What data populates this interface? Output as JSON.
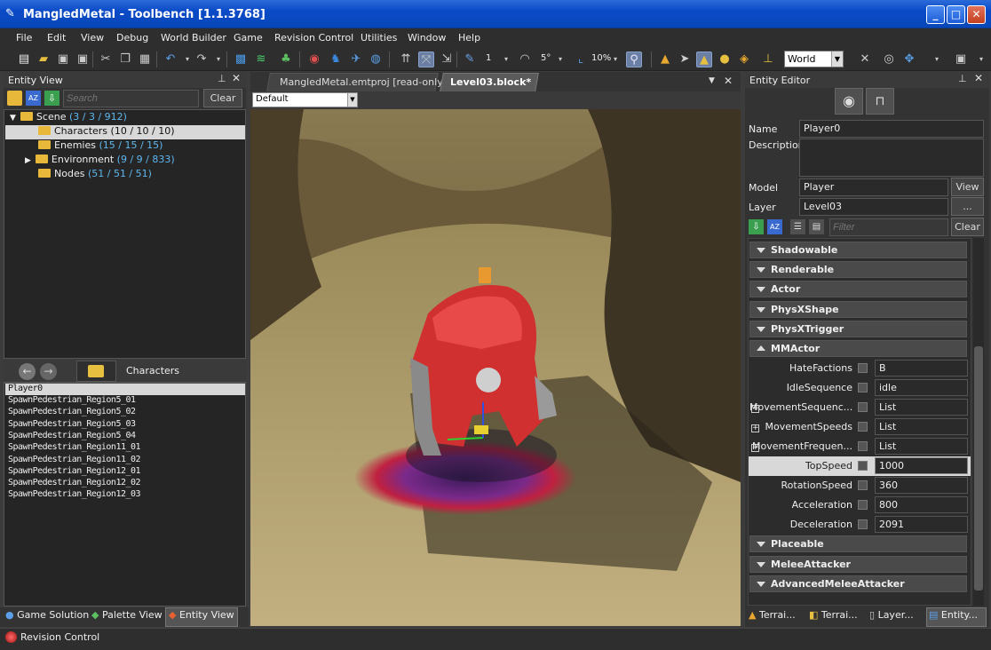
{
  "window": {
    "title": "MangledMetal - Toolbench [1.1.3768]"
  },
  "menu": [
    "File",
    "Edit",
    "View",
    "Debug",
    "World Builder",
    "Game",
    "Revision Control",
    "Utilities",
    "Window",
    "Help"
  ],
  "toolbar": {
    "step_value": "1",
    "angle_value": "5°",
    "scale_value": "10%",
    "space_select": "World"
  },
  "entity_view": {
    "title": "Entity View",
    "search_placeholder": "Search",
    "clear_label": "Clear",
    "tree": [
      {
        "label": "Scene",
        "count": "(3 / 3 / 912)"
      },
      {
        "label": "Characters",
        "count": "(10 / 10 / 10)"
      },
      {
        "label": "Enemies",
        "count": "(15 / 15 / 15)"
      },
      {
        "label": "Environment",
        "count": "(9 / 9 / 833)"
      },
      {
        "label": "Nodes",
        "count": "(51 / 51 / 51)"
      }
    ],
    "list_title": "Characters",
    "list": [
      "Player0",
      "SpawnPedestrian_Region5_01",
      "SpawnPedestrian_Region5_02",
      "SpawnPedestrian_Region5_03",
      "SpawnPedestrian_Region5_04",
      "SpawnPedestrian_Region11_01",
      "SpawnPedestrian_Region11_02",
      "SpawnPedestrian_Region12_01",
      "SpawnPedestrian_Region12_02",
      "SpawnPedestrian_Region12_03"
    ]
  },
  "bottom_tabs_left": [
    "Game Solution",
    "Palette View",
    "Entity View"
  ],
  "status": {
    "revision_control": "Revision Control"
  },
  "doc_tabs": [
    "MangledMetal.emtproj [read-only]",
    "Level03.block*"
  ],
  "viewport": {
    "camera_select": "Default"
  },
  "entity_editor": {
    "title": "Entity Editor",
    "name_label": "Name",
    "name_value": "Player0",
    "description_label": "Description",
    "model_label": "Model",
    "model_value": "Player",
    "view_label": "View",
    "layer_label": "Layer",
    "layer_value": "Level03",
    "browse_label": "...",
    "filter_placeholder": "Filter",
    "clear_label": "Clear",
    "sections_top": [
      "Shadowable",
      "Renderable",
      "Actor",
      "PhysXShape",
      "PhysXTrigger"
    ],
    "open_section": "MMActor",
    "properties": [
      {
        "label": "HateFactions",
        "value": "B"
      },
      {
        "label": "IdleSequence",
        "value": "idle"
      },
      {
        "label": "MovementSequenc...",
        "value": "List"
      },
      {
        "label": "MovementSpeeds",
        "value": "List"
      },
      {
        "label": "MovementFrequen...",
        "value": "List"
      },
      {
        "label": "TopSpeed",
        "value": "1000"
      },
      {
        "label": "RotationSpeed",
        "value": "360"
      },
      {
        "label": "Acceleration",
        "value": "800"
      },
      {
        "label": "Deceleration",
        "value": "2091"
      }
    ],
    "sections_bottom": [
      "Placeable",
      "MeleeAttacker",
      "AdvancedMeleeAttacker"
    ]
  },
  "bottom_tabs_right": [
    "Terrai...",
    "Terrai...",
    "Layer...",
    "Entity..."
  ]
}
